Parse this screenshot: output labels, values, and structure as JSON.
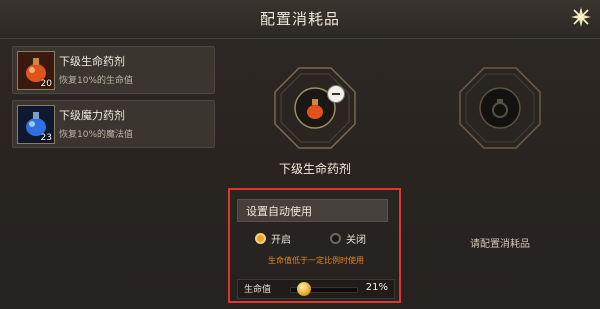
{
  "window": {
    "title": "配置消耗品"
  },
  "items": [
    {
      "name": "下级生命药剂",
      "desc": "恢复10%的生命值",
      "count": "20",
      "icon": "red-potion-icon"
    },
    {
      "name": "下级魔力药剂",
      "desc": "恢复10%的魔法值",
      "count": "23",
      "icon": "blue-potion-icon"
    }
  ],
  "slots": {
    "slot1_label": "下级生命药剂",
    "slot2_label": "请配置消耗品"
  },
  "auto_use": {
    "title": "设置自动使用",
    "on_label": "开启",
    "off_label": "关闭",
    "selected": "开启",
    "hint": "生命值低于一定比例时使用",
    "slider_label": "生命值",
    "percent_text": "21%",
    "percent_value": 0.21
  },
  "colors": {
    "highlight_border": "#e0352b",
    "accent": "#e8a432",
    "hint": "#e0861f"
  }
}
